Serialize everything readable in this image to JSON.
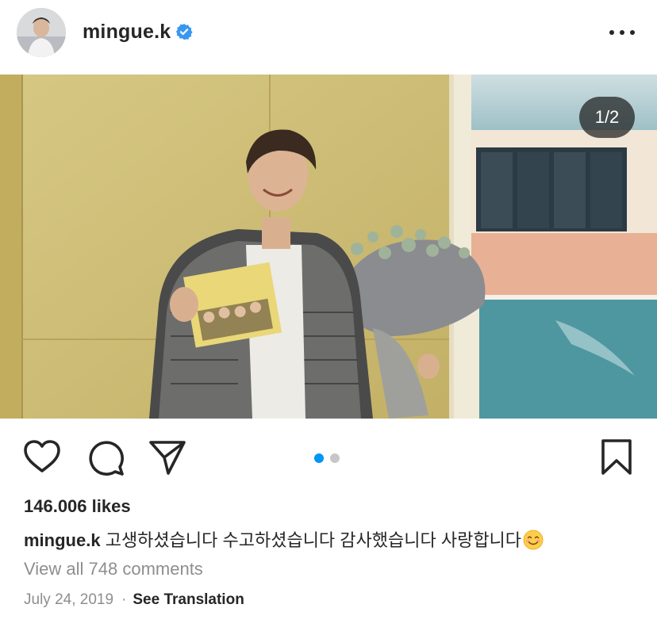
{
  "post": {
    "username": "mingue.k",
    "photo_counter": "1/2",
    "likes": "146.006 likes",
    "caption_username": "mingue.k",
    "caption_text": "고생하셨습니다 수고하셨습니다 감사했습니다 사랑합니다",
    "view_comments": "View all 748 comments",
    "date": "July 24, 2019",
    "separator": "·",
    "see_translation": "See Translation",
    "carousel": {
      "total": 2,
      "current": 1
    }
  },
  "icons": {
    "verified": "verified-badge-icon",
    "more": "more-options-icon",
    "like": "heart-icon",
    "comment": "comment-bubble-icon",
    "share": "paper-plane-icon",
    "save": "bookmark-icon",
    "emoji": "smiling-face-emoji"
  },
  "colors": {
    "verified_blue": "#3897f0",
    "dot_active": "#0095f6",
    "dot_inactive": "#c7c7c7",
    "muted_text": "#8e8e8e"
  }
}
